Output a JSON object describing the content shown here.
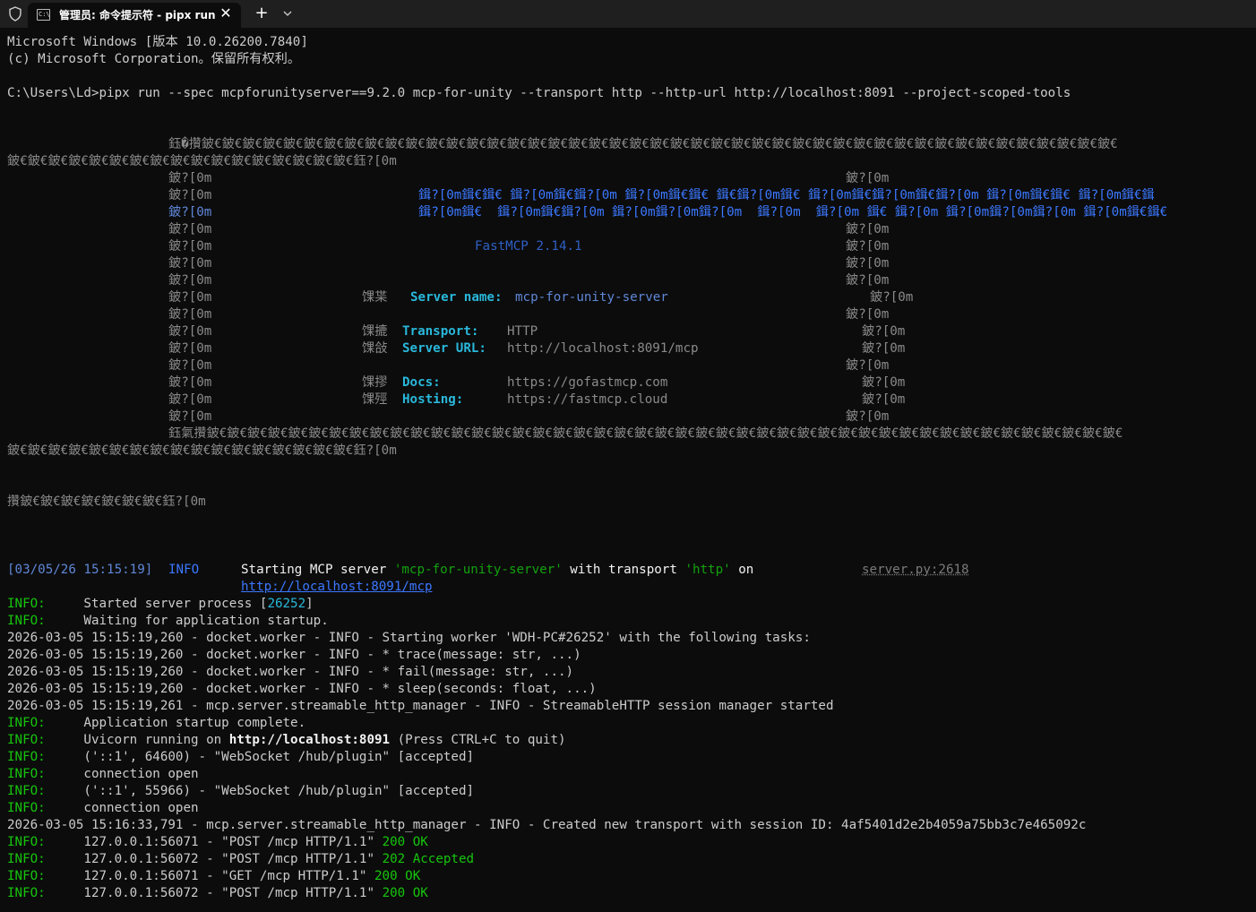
{
  "window": {
    "tab_title": "管理员: 命令提示符 - pipx  run",
    "tab_icon_text": "C:\\",
    "close_glyph": "✕",
    "new_tab_glyph": "+",
    "dropdown_glyph": "⌄"
  },
  "header": {
    "line1": "Microsoft Windows [版本 10.0.26200.7840]",
    "line2": "(c) Microsoft Corporation。保留所有权利。",
    "command": "C:\\Users\\Ld>pipx run --spec mcpforunityserver==9.2.0 mcp-for-unity --transport http --http-url http://localhost:8091 --project-scoped-tools"
  },
  "banner": {
    "top_border_1": "鈺�攢鈹€鈹€鈹€鈹€鈹€鈹€鈹€鈹€鈹€鈹€鈹€鈹€鈹€鈹€鈹€鈹€鈹€鈹€鈹€鈹€鈹€鈹€鈹€鈹€鈹€鈹€鈹€鈹€鈹€鈹€鈹€鈹€鈹€鈹€鈹€鈹€鈹€鈹€鈹€鈹€鈹€鈹€鈹€鈹€鈹€",
    "top_border_2": "鈹€鈹€鈹€鈹€鈹€鈹€鈹€鈹€鈹€鈹€鈹€鈹€鈹€鈹€鈹€鈹€鈹€鈺?[0m",
    "bottom_border_1": "鈺氣攢鈹€鈹€鈹€鈹€鈹€鈹€鈹€鈹€鈹€鈹€鈹€鈹€鈹€鈹€鈹€鈹€鈹€鈹€鈹€鈹€鈹€鈹€鈹€鈹€鈹€鈹€鈹€鈹€鈹€鈹€鈹€鈹€鈹€鈹€鈹€鈹€鈹€鈹€鈹€鈹€鈹€鈹€鈹€鈹€鈹€",
    "bottom_border_2": "鈹€鈹€鈹€鈹€鈹€鈹€鈹€鈹€鈹€鈹€鈹€鈹€鈹€鈹€鈹€鈹€鈹€鈺?[0m",
    "side": "鈹?[0m",
    "logo_line1": "鍓?[0m鍓€鍓€ 鍓?[0m鍓€鍓?[0m 鍓?[0m鍓€鍓€ 鍓€鍓?[0m鍓€ 鍓?[0m鍓€鍓?[0m鍓€鍓?[0m 鍓?[0m鍓€鍓€ 鍓?[0m鍓€鍓",
    "logo_line2": "鍓?[0m鍓€  鍓?[0m鍓€鍓?[0m 鍓?[0m鍓?[0m鍓?[0m  鍓?[0m  鍓?[0m 鍓€ 鍓?[0m 鍓?[0m鍓?[0m鍓?[0m 鍓?[0m鍓€鍓€",
    "version": "FastMCP 2.14.1",
    "server_name_icon": "馃枼",
    "server_name_label": "Server name:",
    "server_name_value": "mcp-for-unity-server",
    "transport_icon": "馃摝",
    "transport_label": "Transport:",
    "transport_value": "HTTP",
    "url_icon": "馃敆",
    "url_label": "Server URL:",
    "url_value": "http://localhost:8091/mcp",
    "docs_icon": "馃摎",
    "docs_label": "Docs:",
    "docs_value": "https://gofastmcp.com",
    "hosting_icon": "馃殌",
    "hosting_label": "Hosting:",
    "hosting_value": "https://fastmcp.cloud",
    "small_box": "攢鈹€鈹€鈹€鈹€鈹€鈹€鈹€鈺?[0m"
  },
  "rich_log": {
    "time": "[03/05/26 15:15:19]",
    "level": "INFO",
    "msg_a": "Starting MCP server ",
    "msg_name": "'mcp-for-unity-server'",
    "msg_b": " with transport ",
    "msg_transport": "'http'",
    "msg_c": " on",
    "source": "server.py:2618",
    "url": "http://localhost:8091/mcp"
  },
  "log": {
    "l1_level": "INFO:",
    "l1_text": "     Started server process [",
    "l1_pid": "26252",
    "l1_end": "]",
    "l2_level": "INFO:",
    "l2_text": "     Waiting for application startup.",
    "l3": "2026-03-05 15:15:19,260 - docket.worker - INFO - Starting worker 'WDH-PC#26252' with the following tasks:",
    "l4": "2026-03-05 15:15:19,260 - docket.worker - INFO - * trace(message: str, ...)",
    "l5": "2026-03-05 15:15:19,260 - docket.worker - INFO - * fail(message: str, ...)",
    "l6": "2026-03-05 15:15:19,260 - docket.worker - INFO - * sleep(seconds: float, ...)",
    "l7": "2026-03-05 15:15:19,261 - mcp.server.streamable_http_manager - INFO - StreamableHTTP session manager started",
    "l8_level": "INFO:",
    "l8_text": "     Application startup complete.",
    "l9_level": "INFO:",
    "l9_text": "     Uvicorn running on ",
    "l9_url": "http://localhost:8091",
    "l9_end": " (Press CTRL+C to quit)",
    "l10_level": "INFO:",
    "l10_text": "     ('::1', 64600) - \"WebSocket /hub/plugin\" [accepted]",
    "l11_level": "INFO:",
    "l11_text": "     connection open",
    "l12_level": "INFO:",
    "l12_text": "     ('::1', 55966) - \"WebSocket /hub/plugin\" [accepted]",
    "l13_level": "INFO:",
    "l13_text": "     connection open",
    "l14": "2026-03-05 15:16:33,791 - mcp.server.streamable_http_manager - INFO - Created new transport with session ID: 4af5401d2e2b4059a75bb3c7e465092c",
    "l15_level": "INFO:",
    "l15_text": "     127.0.0.1:56071 - \"POST /mcp HTTP/1.1\" ",
    "l15_status": "200 OK",
    "l16_level": "INFO:",
    "l16_text": "     127.0.0.1:56072 - \"POST /mcp HTTP/1.1\" ",
    "l16_status": "202 Accepted",
    "l17_level": "INFO:",
    "l17_text": "     127.0.0.1:56071 - \"GET /mcp HTTP/1.1\" ",
    "l17_status": "200 OK",
    "l18_level": "INFO:",
    "l18_text": "     127.0.0.1:56072 - \"POST /mcp HTTP/1.1\" ",
    "l18_status": "200 OK"
  }
}
